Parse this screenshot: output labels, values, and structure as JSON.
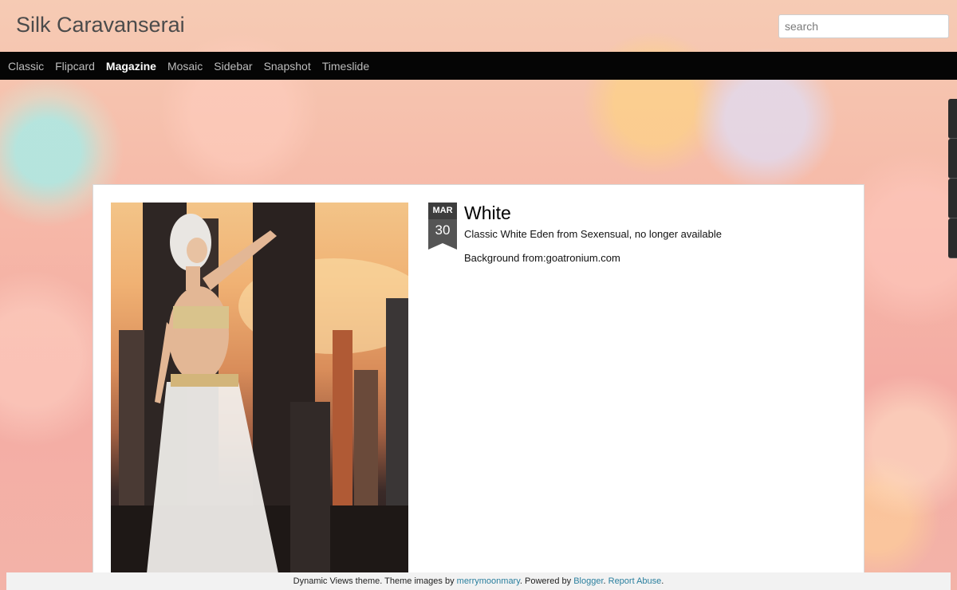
{
  "header": {
    "site_title": "Silk Caravanserai",
    "search_placeholder": "search"
  },
  "nav": {
    "items": [
      {
        "label": "Classic",
        "active": false
      },
      {
        "label": "Flipcard",
        "active": false
      },
      {
        "label": "Magazine",
        "active": true
      },
      {
        "label": "Mosaic",
        "active": false
      },
      {
        "label": "Sidebar",
        "active": false
      },
      {
        "label": "Snapshot",
        "active": false
      },
      {
        "label": "Timeslide",
        "active": false
      }
    ]
  },
  "post": {
    "month": "MAR",
    "day": "30",
    "title": "White",
    "line1": "Classic White Eden from Sexensual, no longer available",
    "line2": "Background from:goatronium.com"
  },
  "footer": {
    "text1": "Dynamic Views theme. Theme images by ",
    "link1": "merrymoonmary",
    "text2": ". Powered by ",
    "link2": "Blogger",
    "text3": ". ",
    "link3": "Report Abuse",
    "text4": "."
  },
  "colors": {
    "nav_bg": "#050505",
    "link": "#2a7f9e",
    "badge": "#555555"
  }
}
